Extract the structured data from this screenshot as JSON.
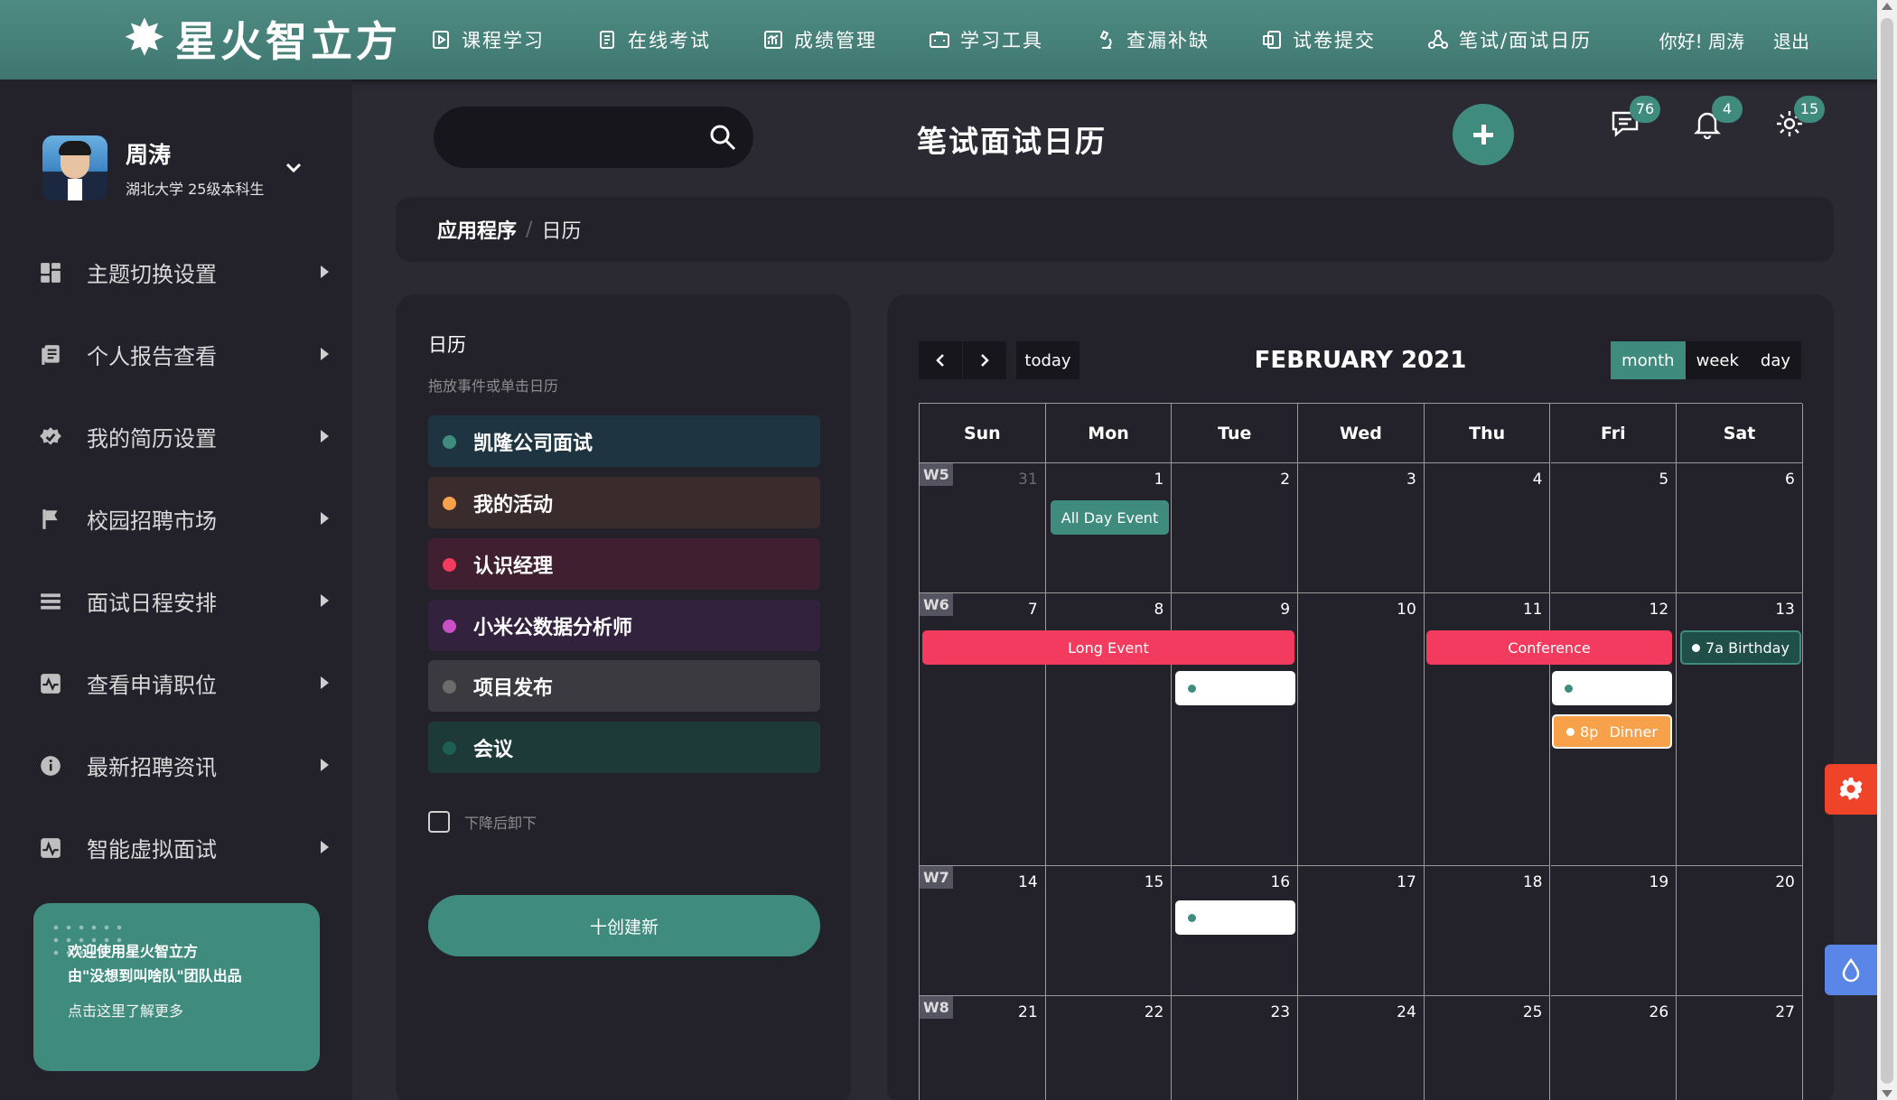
{
  "app": {
    "logo_text": "星火智立方",
    "nav": [
      {
        "label": "课程学习",
        "icon": "course-icon"
      },
      {
        "label": "在线考试",
        "icon": "exam-icon"
      },
      {
        "label": "成绩管理",
        "icon": "grades-icon"
      },
      {
        "label": "学习工具",
        "icon": "tools-icon"
      },
      {
        "label": "查漏补缺",
        "icon": "microscope-icon"
      },
      {
        "label": "试卷提交",
        "icon": "submit-icon"
      },
      {
        "label": "笔试/面试日历",
        "icon": "calendar-network-icon"
      }
    ],
    "greeting": "你好! 周涛",
    "logout": "退出"
  },
  "profile": {
    "name": "周涛",
    "school": "湖北大学 25级本科生"
  },
  "sidebar": {
    "items": [
      {
        "label": "主题切换设置",
        "icon": "dashboard-icon"
      },
      {
        "label": "个人报告查看",
        "icon": "report-icon"
      },
      {
        "label": "我的简历设置",
        "icon": "resume-icon"
      },
      {
        "label": "校园招聘市场",
        "icon": "flag-icon"
      },
      {
        "label": "面试日程安排",
        "icon": "list-icon"
      },
      {
        "label": "查看申请职位",
        "icon": "activity-icon"
      },
      {
        "label": "最新招聘资讯",
        "icon": "info-icon"
      },
      {
        "label": "智能虚拟面试",
        "icon": "pulse-icon"
      }
    ],
    "promo": {
      "line1": "欢迎使用星火智立方",
      "line2": "由\"没想到叫啥队\"团队出品",
      "line3": "点击这里了解更多"
    }
  },
  "header": {
    "title": "笔试面试日历",
    "badges": {
      "messages": "76",
      "notifications": "4",
      "settings": "15"
    }
  },
  "breadcrumb": {
    "root": "应用程序",
    "current": "日历"
  },
  "external_events": {
    "title": "日历",
    "hint": "拖放事件或单击日历",
    "items": [
      {
        "label": "凯隆公司面试",
        "color": "#3f8c7f",
        "bg": "#1e3440"
      },
      {
        "label": "我的活动",
        "color": "#f7a24b",
        "bg": "#3a2c2c"
      },
      {
        "label": "认识经理",
        "color": "#f23b5e",
        "bg": "#3f1f30"
      },
      {
        "label": "小米公数据分析师",
        "color": "#c94fc4",
        "bg": "#33223d"
      },
      {
        "label": "项目发布",
        "color": "#6b6b6b",
        "bg": "#3a3a40"
      },
      {
        "label": "会议",
        "color": "#1f5e52",
        "bg": "#1d3a39"
      }
    ],
    "drop_remove_label": "下降后卸下",
    "create_label": "十创建新"
  },
  "calendar": {
    "title": "FEBRUARY 2021",
    "today_label": "today",
    "views": [
      "month",
      "week",
      "day"
    ],
    "active_view": "month",
    "weekdays": [
      "Sun",
      "Mon",
      "Tue",
      "Wed",
      "Thu",
      "Fri",
      "Sat"
    ],
    "weeks": [
      {
        "label": "W5",
        "days": [
          "31",
          "1",
          "2",
          "3",
          "4",
          "5",
          "6"
        ]
      },
      {
        "label": "W6",
        "days": [
          "7",
          "8",
          "9",
          "10",
          "11",
          "12",
          "13"
        ]
      },
      {
        "label": "W7",
        "days": [
          "14",
          "15",
          "16",
          "17",
          "18",
          "19",
          "20"
        ]
      },
      {
        "label": "W8",
        "days": [
          "21",
          "22",
          "23",
          "24",
          "25",
          "26",
          "27"
        ]
      }
    ],
    "events": {
      "all_day": "All Day Event",
      "long": "Long Event",
      "conference": "Conference",
      "birthday": "7a Birthday",
      "dinner_time": "8p",
      "dinner": "Dinner"
    },
    "colors": {
      "accent": "#3f8c7f",
      "red": "#f23b5e",
      "orange": "#f7a24b"
    }
  },
  "floats": {
    "settings_icon": "gear-icon",
    "theme_icon": "drop-icon"
  }
}
